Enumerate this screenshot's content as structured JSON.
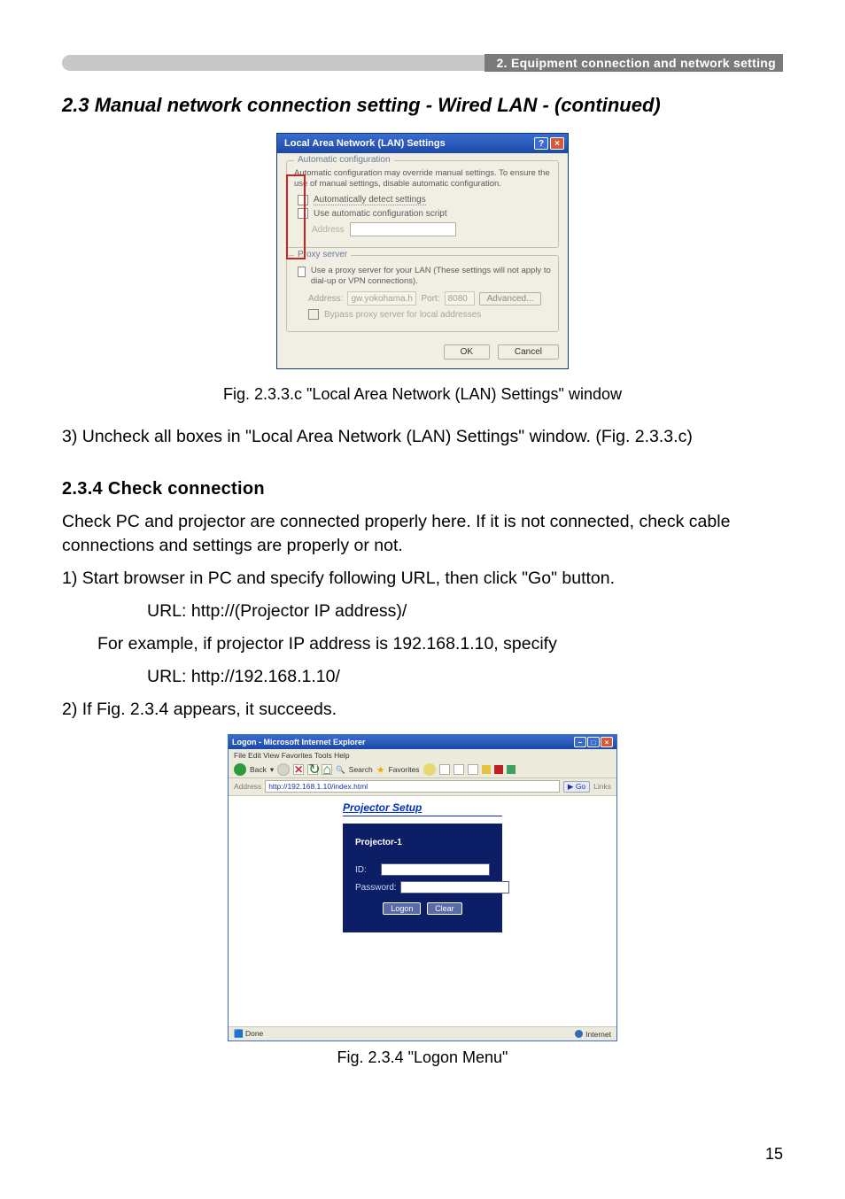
{
  "header": {
    "bar_text": "2. Equipment connection and network setting"
  },
  "section_title": "2.3 Manual network connection setting - Wired LAN - (continued)",
  "lan_dialog": {
    "title": "Local Area Network (LAN) Settings",
    "group_auto": {
      "title": "Automatic configuration",
      "desc": "Automatic configuration may override manual settings. To ensure the use of manual settings, disable automatic configuration.",
      "chk_auto_detect": "Automatically detect settings",
      "chk_auto_script": "Use automatic configuration script",
      "address_label": "Address"
    },
    "group_proxy": {
      "title": "Proxy server",
      "desc": "Use a proxy server for your LAN (These settings will not apply to dial-up or VPN connections).",
      "address_label": "Address:",
      "address_value": "gw.yokohama.hit",
      "port_label": "Port:",
      "port_value": "8080",
      "advanced": "Advanced...",
      "bypass": "Bypass proxy server for local addresses"
    },
    "ok": "OK",
    "cancel": "Cancel"
  },
  "caption_lan": "Fig. 2.3.3.c \"Local Area Network (LAN) Settings\" window",
  "step3": "3) Uncheck all boxes in \"Local Area Network (LAN) Settings\" window. (Fig. 2.3.3.c)",
  "subhead_234": "2.3.4 Check connection",
  "check_p1": "Check PC and projector are connected properly here. If it is not connected, check cable connections and settings are properly or not.",
  "check_p2": "1) Start browser in PC and specify following URL, then click \"Go\" button.",
  "url_template": "URL: http://(Projector IP address)/",
  "example_line": "For example, if projector IP address is 192.168.1.10, specify",
  "url_example": "URL: http://192.168.1.10/",
  "check_p3": "2) If Fig. 2.3.4 appears, it succeeds.",
  "ie": {
    "title": "Logon - Microsoft Internet Explorer",
    "menu": "File   Edit   View   Favorites   Tools   Help",
    "back": "Back",
    "search": "Search",
    "favorites": "Favorites",
    "address_label": "Address",
    "address_value": "http://192.168.1.10/index.html",
    "go": "Go",
    "links": "Links",
    "ps_title": "Projector Setup",
    "projector_name": "Projector-1",
    "id_label": "ID:",
    "pw_label": "Password:",
    "logon": "Logon",
    "clear": "Clear",
    "status_left": "Done",
    "status_right": "Internet"
  },
  "caption_logon": "Fig. 2.3.4 \"Logon Menu\"",
  "page_number": "15"
}
